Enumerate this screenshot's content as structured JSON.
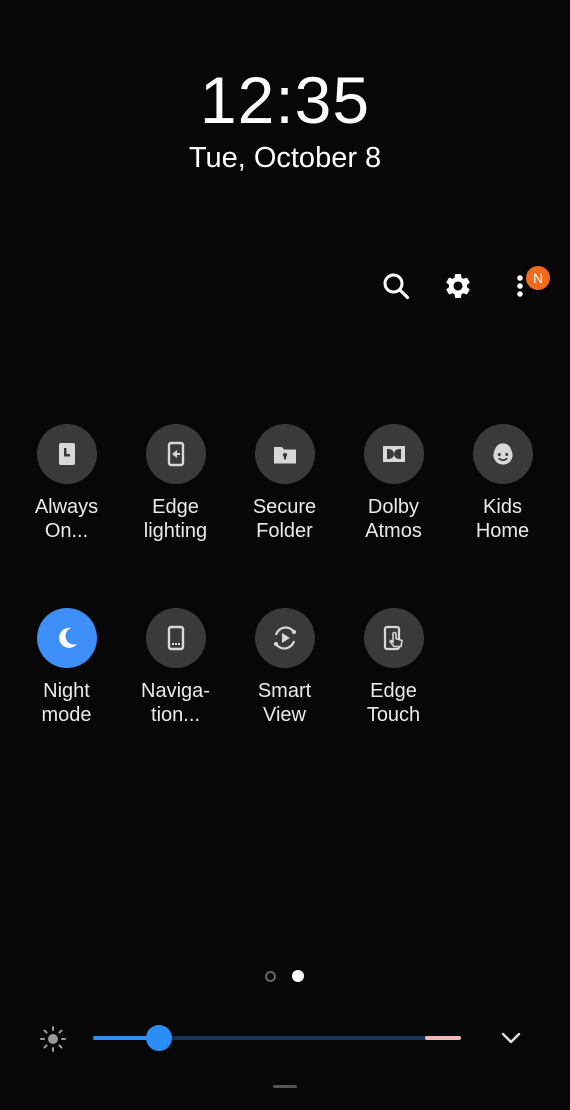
{
  "clock": {
    "time": "12:35",
    "date": "Tue, October 8"
  },
  "top_actions": {
    "search_icon": "search-icon",
    "settings_icon": "gear-icon",
    "more_icon": "more-vert-icon",
    "notification_badge": "N"
  },
  "tiles": [
    {
      "lines": [
        "Always",
        "On..."
      ],
      "icon": "always-on-display-icon",
      "active": false
    },
    {
      "lines": [
        "Edge",
        "lighting"
      ],
      "icon": "edge-lighting-icon",
      "active": false
    },
    {
      "lines": [
        "Secure",
        "Folder"
      ],
      "icon": "secure-folder-icon",
      "active": false
    },
    {
      "lines": [
        "Dolby",
        "Atmos"
      ],
      "icon": "dolby-atmos-icon",
      "active": false
    },
    {
      "lines": [
        "Kids",
        "Home"
      ],
      "icon": "kids-home-icon",
      "active": false
    },
    {
      "lines": [
        "Night",
        "mode"
      ],
      "icon": "moon-icon",
      "active": true
    },
    {
      "lines": [
        "Naviga-",
        "tion..."
      ],
      "icon": "navigation-bar-icon",
      "active": false
    },
    {
      "lines": [
        "Smart",
        "View"
      ],
      "icon": "smart-view-icon",
      "active": false
    },
    {
      "lines": [
        "Edge",
        "Touch"
      ],
      "icon": "edge-touch-icon",
      "active": false
    }
  ],
  "pager": {
    "page_count": 2,
    "current_page": 2
  },
  "brightness": {
    "icon": "sun-icon",
    "level": 0.18,
    "expand_icon": "chevron-down-icon"
  },
  "colors": {
    "background": "#070707",
    "tile_off": "#3a3a3a",
    "tile_on": "#3d8ef6",
    "accent": "#2b8ef4",
    "badge": "#f06c1c"
  }
}
